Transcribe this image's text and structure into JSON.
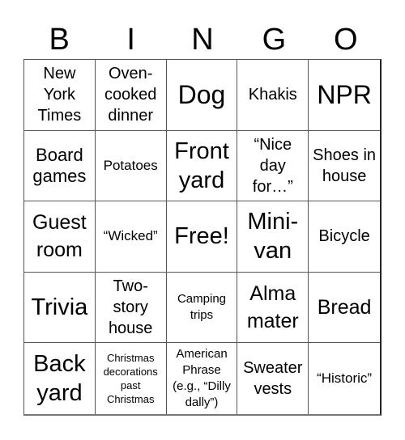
{
  "header": [
    "B",
    "I",
    "N",
    "G",
    "O"
  ],
  "cells": [
    {
      "text": "New York Times",
      "size": "s-s"
    },
    {
      "text": "Oven-cooked dinner",
      "size": "s-s"
    },
    {
      "text": "Dog",
      "size": "s-xl"
    },
    {
      "text": "Khakis",
      "size": "s-s"
    },
    {
      "text": "NPR",
      "size": "s-xl"
    },
    {
      "text": "Board games",
      "size": "s-m"
    },
    {
      "text": "Potatoes",
      "size": "s-xs"
    },
    {
      "text": "Front yard",
      "size": "s-l"
    },
    {
      "text": "“Nice day for…”",
      "size": "s-s"
    },
    {
      "text": "Shoes in house",
      "size": "s-s"
    },
    {
      "text": "Guest room",
      "size": "s-ml"
    },
    {
      "text": "“Wicked”",
      "size": "s-xs"
    },
    {
      "text": "Free!",
      "size": "s-l"
    },
    {
      "text": "Mini-van",
      "size": "s-l"
    },
    {
      "text": "Bicycle",
      "size": "s-s"
    },
    {
      "text": "Trivia",
      "size": "s-l"
    },
    {
      "text": "Two-story house",
      "size": "s-s"
    },
    {
      "text": "Camping trips",
      "size": "s-xxs"
    },
    {
      "text": "Alma mater",
      "size": "s-ml"
    },
    {
      "text": "Bread",
      "size": "s-ml"
    },
    {
      "text": "Back yard",
      "size": "s-l"
    },
    {
      "text": "Christmas decorations past Christmas",
      "size": "s-tiny"
    },
    {
      "text": "American Phrase (e.g., “Dilly dally”)",
      "size": "s-xxs"
    },
    {
      "text": "Sweater vests",
      "size": "s-s"
    },
    {
      "text": "“Historic”",
      "size": "s-xs"
    }
  ]
}
